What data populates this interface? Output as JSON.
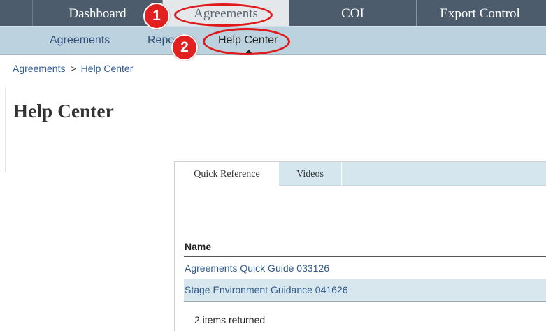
{
  "top_nav": {
    "tabs": [
      {
        "label": "Dashboard"
      },
      {
        "label": "Agreements"
      },
      {
        "label": "COI"
      },
      {
        "label": "Export Control"
      }
    ]
  },
  "sub_nav": {
    "items": [
      {
        "label": "Agreements"
      },
      {
        "label": "Repo"
      },
      {
        "label": "Help Center"
      }
    ]
  },
  "annotations": {
    "badge_1": "1",
    "badge_2": "2",
    "highlight_color": "#e01a1a"
  },
  "breadcrumb": {
    "items": [
      "Agreements",
      "Help Center"
    ],
    "separator": ">"
  },
  "page": {
    "title": "Help Center"
  },
  "help_tabs": [
    {
      "label": "Quick Reference"
    },
    {
      "label": "Videos"
    }
  ],
  "table": {
    "column_header": "Name",
    "rows": [
      {
        "name": "Agreements Quick Guide 033126"
      },
      {
        "name": "Stage Environment Guidance 041626"
      }
    ],
    "count_text": "2 items returned"
  },
  "colors": {
    "top_nav_bg": "#4d5c6c",
    "sub_nav_bg": "#bcd2de",
    "link": "#2f5a8a",
    "alt_row": "#d8e7ee"
  }
}
